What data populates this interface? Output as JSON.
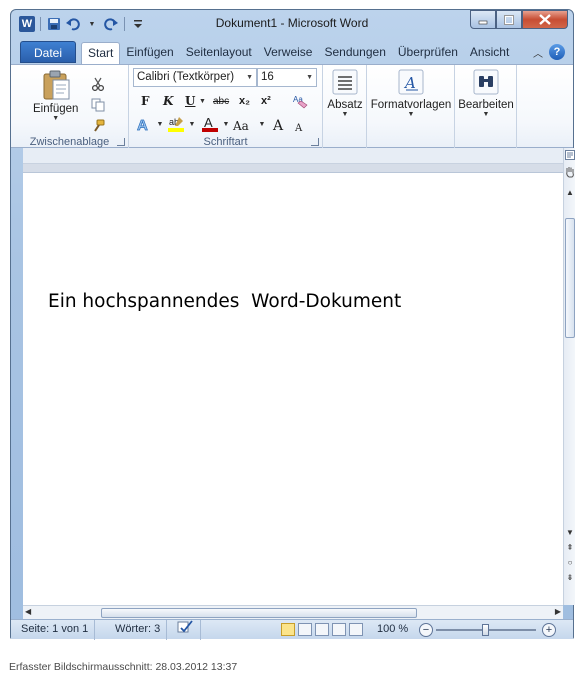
{
  "window": {
    "title": "Dokument1  -  Microsoft Word"
  },
  "qat": {
    "logo_letter": "W"
  },
  "tabs": {
    "file": "Datei",
    "items": [
      "Start",
      "Einfügen",
      "Seitenlayout",
      "Verweise",
      "Sendungen",
      "Überprüfen",
      "Ansicht"
    ],
    "help": "?"
  },
  "ribbon": {
    "clipboard": {
      "label": "Zwischenablage",
      "paste": "Einfügen"
    },
    "font": {
      "label": "Schriftart",
      "font_name": "Calibri (Textkörper)",
      "font_size": "16",
      "bold": "F",
      "italic": "K",
      "underline": "U",
      "strike": "abc",
      "subscript": "x₂",
      "superscript": "x²",
      "change_case": "Aa",
      "grow": "A",
      "shrink": "A"
    },
    "paragraph": {
      "label": "Absatz"
    },
    "styles": {
      "label": "Formatvorlagen"
    },
    "editing": {
      "label": "Bearbeiten"
    }
  },
  "document": {
    "text": "Ein hochspannendes  Word-Dokument"
  },
  "statusbar": {
    "page": "Seite: 1 von 1",
    "words": "Wörter: 3",
    "zoom": "100 %",
    "zoom_level_percent": 100
  },
  "caption": "Erfasster Bildschirmausschnitt: 28.03.2012 13:37",
  "colors": {
    "file_tab": "#2a5fab",
    "highlight": "#ffff00",
    "font_color": "#c00000"
  }
}
